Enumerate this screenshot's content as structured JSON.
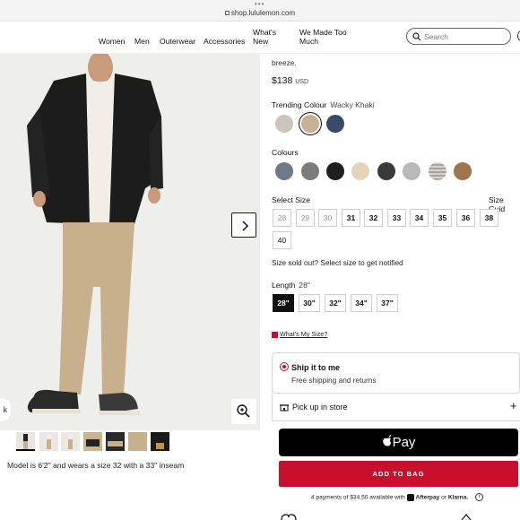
{
  "browser": {
    "url": "shop.lululemon.com"
  },
  "nav": {
    "items": [
      "Women",
      "Men",
      "Outerwear",
      "Accessories",
      "What's",
      "New",
      "We Made Too",
      "Much"
    ],
    "search_placeholder": "Search"
  },
  "product": {
    "description_tail": "breeze.",
    "price": "$138",
    "currency": "USD",
    "trending_label": "Trending Colour",
    "trending_value": "Wacky Khaki",
    "colours_label": "Colours",
    "trending_swatches": [
      "#cdc5bb",
      "#c4b197",
      "#3a4a66"
    ],
    "colour_swatches": [
      "#6c7a89",
      "#7b7b7b",
      "#1f1f1f",
      "#e4d4bc",
      "#3a3a3a",
      "#b9b9b9",
      "#a8a39b",
      "#a0754d"
    ],
    "select_size_label": "Select Size",
    "size_guide": "Size Guid",
    "sizes": [
      "28",
      "29",
      "30",
      "31",
      "32",
      "33",
      "34",
      "35",
      "36",
      "38",
      "40"
    ],
    "sold_out_sizes": [
      "28",
      "29",
      "30"
    ],
    "sold_out_note": "Size sold out? Select size to get notified",
    "length_label": "Length",
    "length_value": "28\"",
    "lengths": [
      "28\"",
      "30\"",
      "32\"",
      "34\"",
      "37\""
    ],
    "my_size_link": "What's My Size?",
    "model_note": "Model is 6'2\" and wears a size 32 with a 33\" inseam"
  },
  "fulfilment": {
    "ship_title": "Ship it to me",
    "ship_sub": "Free shipping and returns",
    "pickup": "Pick up in store"
  },
  "checkout": {
    "applepay": "Pay",
    "add_to_bag": "ADD TO BAG",
    "installments": "4 payments of $34.50 available with",
    "afterpay": "Afterpay",
    "or": "or",
    "klarna": "Klarna."
  },
  "colors": {
    "accent": "#c8102e",
    "black": "#000000"
  }
}
